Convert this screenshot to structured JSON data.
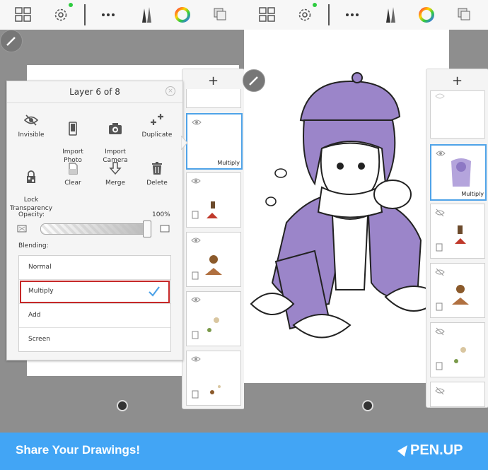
{
  "left_panel": {
    "title": "Layer 6 of 8",
    "actions": [
      {
        "label": "Invisible",
        "icon": "eye-slash-icon"
      },
      {
        "label": "Import\nPhoto",
        "icon": "phone-icon"
      },
      {
        "label": "Import\nCamera",
        "icon": "camera-icon"
      },
      {
        "label": "Duplicate",
        "icon": "duplicate-icon"
      },
      {
        "label": "Lock\nTransparency",
        "icon": "lock-icon"
      },
      {
        "label": "Clear",
        "icon": "eraser-icon"
      },
      {
        "label": "Merge",
        "icon": "merge-arrow-icon"
      },
      {
        "label": "Delete",
        "icon": "trash-icon"
      }
    ],
    "opacity_label": "Opacity:",
    "opacity_value": "100%",
    "opacity_level": 1.0,
    "blending_label": "Blending:",
    "blend_modes": [
      "Normal",
      "Multiply",
      "Add",
      "Screen"
    ],
    "selected_blend": "Multiply"
  },
  "left_layers": {
    "thumb_badge": "Multiply"
  },
  "right_layers": {
    "thumb_badge": "Multiply"
  },
  "footer": {
    "text": "Share Your Drawings!",
    "logo": "PEN.UP"
  },
  "colors": {
    "footer": "#42a5f5",
    "selection": "#4fa3e8",
    "highlight_box": "#c62828",
    "art_fill": "#9b85c9"
  }
}
